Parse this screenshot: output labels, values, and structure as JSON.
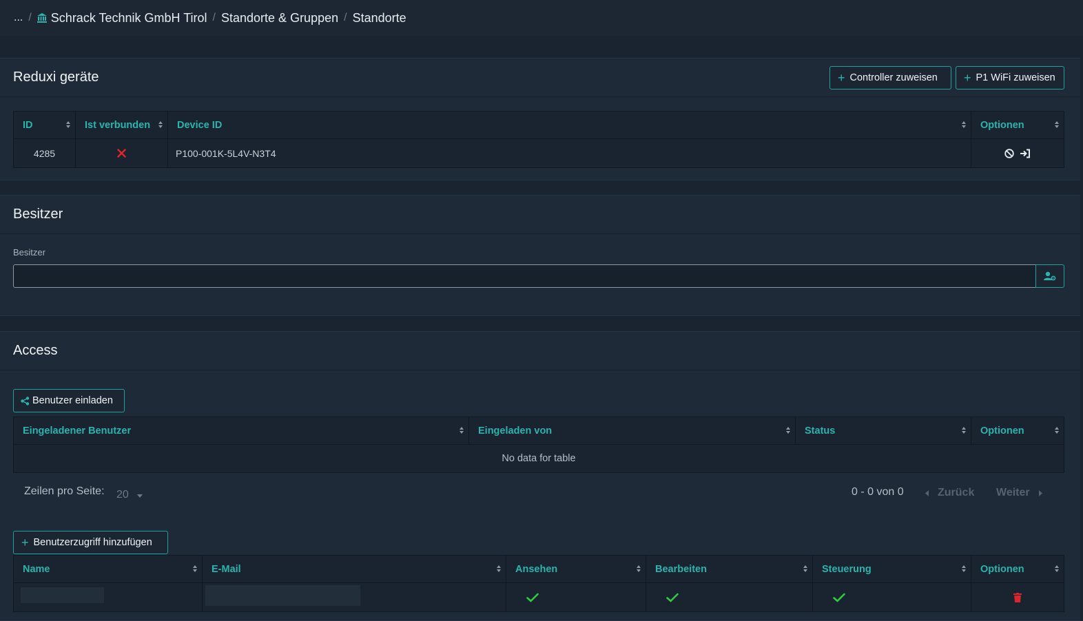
{
  "breadcrumb": {
    "ellipsis": "...",
    "org": "Schrack Technik GmbH Tirol",
    "groups": "Standorte & Gruppen",
    "current": "Standorte"
  },
  "devices": {
    "title": "Reduxi geräte",
    "controller_button": "Controller zuweisen",
    "p1_button": "P1 WiFi zuweisen",
    "columns": [
      "ID",
      "Ist verbunden",
      "Device ID",
      "Optionen"
    ],
    "rows": [
      {
        "id": "4285",
        "connected": false,
        "device_id": "P100-001K-5L4V-N3T4"
      }
    ]
  },
  "owner": {
    "title": "Besitzer",
    "field_label": "Besitzer",
    "value": ""
  },
  "access": {
    "title": "Access",
    "invite_button": "Benutzer einladen",
    "invite_columns": [
      "Eingeladener Benutzer",
      "Eingeladen von",
      "Status",
      "Optionen"
    ],
    "empty_text": "No data for table",
    "rows_per_page_label": "Zeilen pro Seite:",
    "rows_per_page": "20",
    "range_text": "0 - 0 von 0",
    "prev_label": "Zurück",
    "next_label": "Weiter",
    "add_access_button": "Benutzerzugriff hinzufügen",
    "access_columns": [
      "Name",
      "E-Mail",
      "Ansehen",
      "Bearbeiten",
      "Steuerung",
      "Optionen"
    ],
    "access_rows": [
      {
        "name": "",
        "email": "",
        "view": true,
        "edit": true,
        "control": true
      }
    ]
  },
  "colors": {
    "accent": "#2bb3ad",
    "danger": "#e0242c",
    "success": "#2ecc40"
  }
}
